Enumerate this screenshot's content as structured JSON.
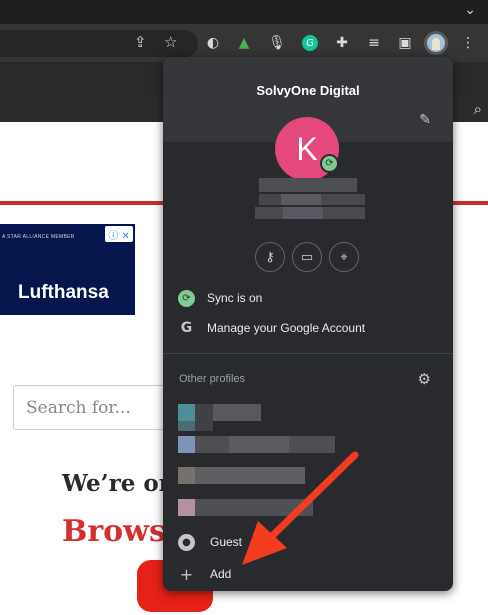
{
  "browser": {
    "tabstrip_chevron": "chevron-down-icon",
    "toolbar_icons": [
      "share-icon",
      "star-icon",
      "extension-logo-icon",
      "extension-chart-icon",
      "microphone-icon",
      "grammarly-icon",
      "puzzle-icon",
      "media-queue-icon",
      "side-panel-icon",
      "profile-avatar-icon",
      "more-menu-icon"
    ]
  },
  "page": {
    "ad": {
      "tagline": "A STAR ALLIANCE MEMBER",
      "brand": "Lufthansa",
      "adchoices": "ⓘ ✕"
    },
    "search_placeholder": "Search for...",
    "heading1": "We’re or",
    "heading2": "Brows"
  },
  "profile_menu": {
    "title": "SolvyOne Digital",
    "avatar_letter": "K",
    "avatar_color": "#e5487b",
    "sync_label": "Sync is on",
    "manage_label": "Manage your Google Account",
    "other_profiles_label": "Other profiles",
    "guest_label": "Guest",
    "add_label": "Add",
    "quick_actions": [
      "key-icon",
      "credit-card-icon",
      "location-pin-icon"
    ]
  },
  "colors": {
    "accent_red": "#c4302b",
    "sync_green": "#81c995",
    "menu_bg": "#292a2d",
    "annotation_arrow": "#f23b1f"
  }
}
